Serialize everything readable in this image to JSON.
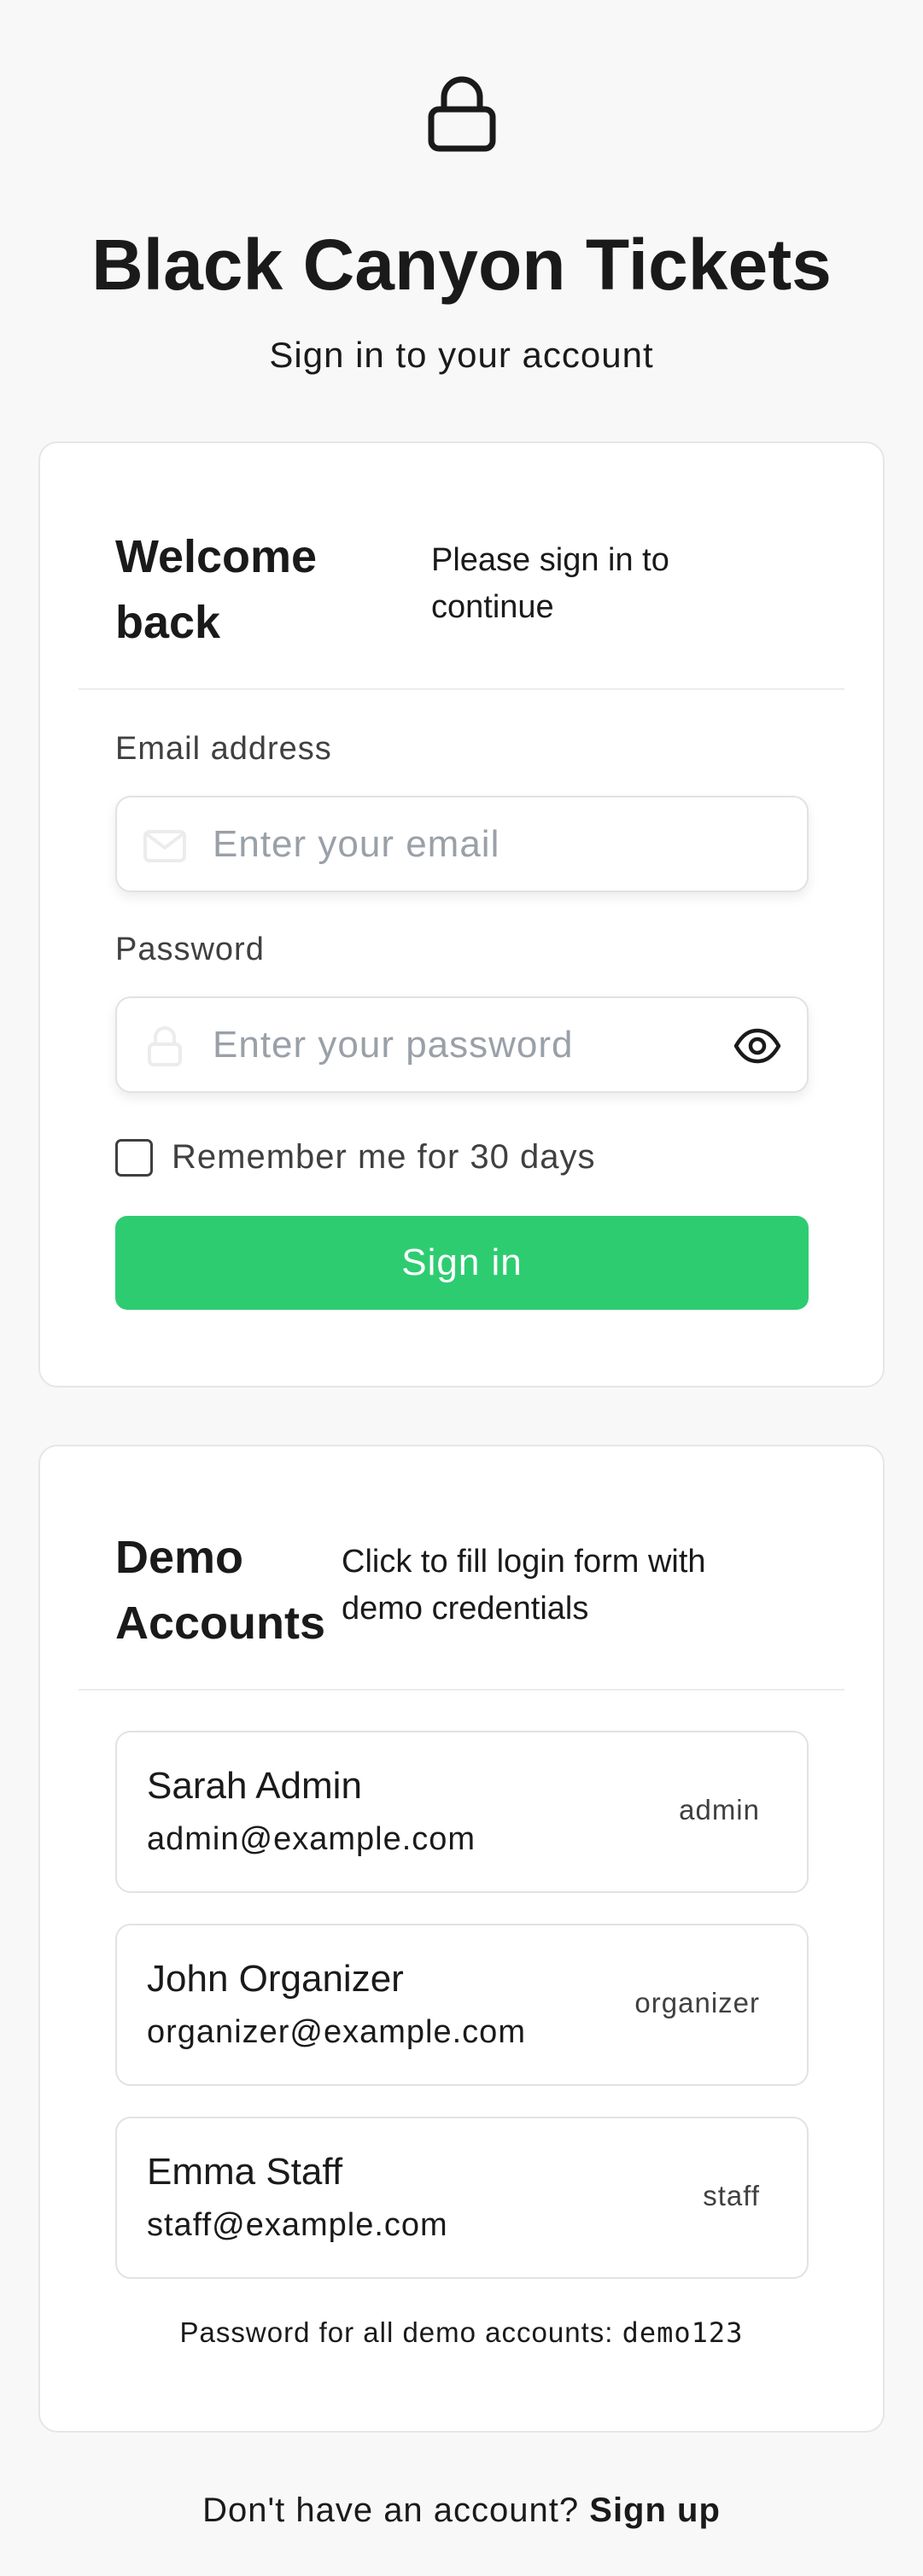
{
  "brand": {
    "icon": "lock-icon",
    "title": "Black Canyon Tickets",
    "subtitle": "Sign in to your account"
  },
  "login_card": {
    "title": "Welcome back",
    "description": "Please sign in to continue",
    "email": {
      "label": "Email address",
      "placeholder": "Enter your email",
      "value": "",
      "icon": "mail-icon"
    },
    "password": {
      "label": "Password",
      "placeholder": "Enter your password",
      "value": "",
      "icon": "lock-icon",
      "toggle_icon": "eye-icon"
    },
    "remember_label": "Remember me for 30 days",
    "remember_checked": false,
    "submit_label": "Sign in"
  },
  "demo_card": {
    "title": "Demo Accounts",
    "description": "Click to fill login form with demo credentials",
    "accounts": [
      {
        "name": "Sarah Admin",
        "email": "admin@example.com",
        "role": "admin"
      },
      {
        "name": "John Organizer",
        "email": "organizer@example.com",
        "role": "organizer"
      },
      {
        "name": "Emma Staff",
        "email": "staff@example.com",
        "role": "staff"
      }
    ],
    "password_note": "Password for all demo accounts:",
    "password_value": "demo123"
  },
  "footer": {
    "prompt": "Don't have an account?",
    "signup_label": "Sign up"
  },
  "colors": {
    "accent": "#2ecc71",
    "background": "#f8f8f8",
    "text": "#1a1a1a",
    "muted": "#404040",
    "placeholder": "#9aa0a8"
  }
}
